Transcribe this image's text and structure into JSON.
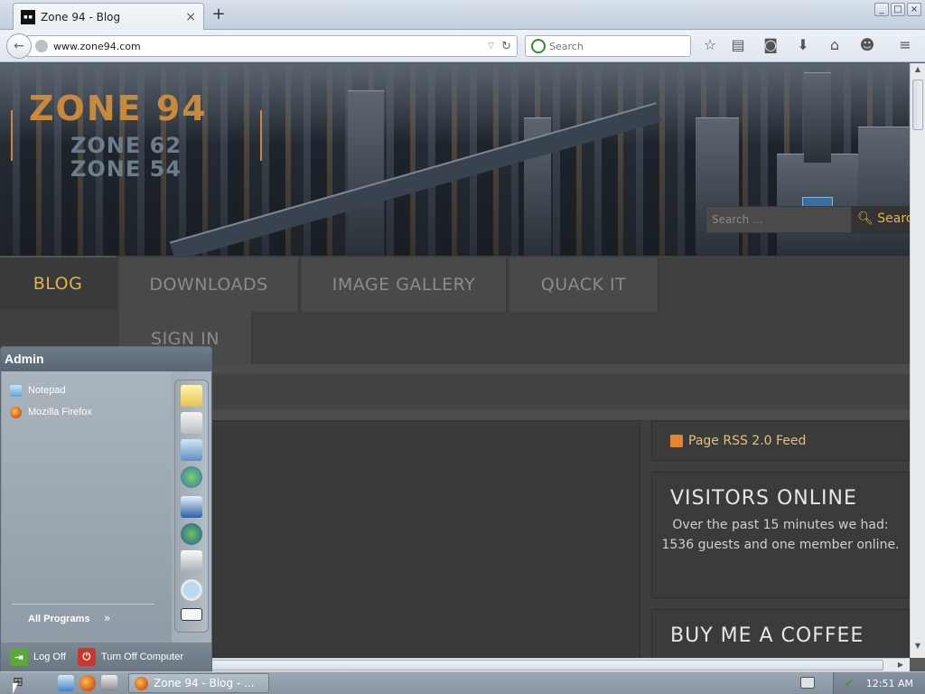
{
  "browser": {
    "tab_title": "Zone 94 - Blog",
    "tab_favicon": "zone94-favicon",
    "tab_close": "×",
    "new_tab": "+",
    "url": "www.zone94.com",
    "search_placeholder": "Search",
    "window_controls": [
      "_",
      "□",
      "×"
    ],
    "toolbar_icons": [
      "bookmark-star-icon",
      "reading-list-icon",
      "pocket-icon",
      "download-icon",
      "home-icon",
      "smiley-icon",
      "menu-icon"
    ]
  },
  "site": {
    "logo_main": "ZONE 94",
    "logo_sub1": "ZONE 62",
    "logo_sub2": "ZONE 54",
    "menu": [
      {
        "label": "BLOG",
        "active": true
      },
      {
        "label": "DOWNLOADS",
        "active": false
      },
      {
        "label": "IMAGE GALLERY",
        "active": false
      },
      {
        "label": "QUACK IT",
        "active": false
      },
      {
        "label": "SIGN IN",
        "active": false
      }
    ],
    "search_placeholder": "Search ...",
    "search_button": "Search",
    "rss_label": "Page RSS 2.0 Feed",
    "visitors_title": "VISITORS ONLINE",
    "visitors_text": "Over the past 15 minutes we had: 1536 guests and one member online.",
    "coffee_title": "BUY ME A COFFEE",
    "accent_color": "#e1b14a"
  },
  "start_menu": {
    "user": "Admin",
    "programs": [
      {
        "label": "Notepad",
        "icon": "notepad-icon"
      },
      {
        "label": "Mozilla Firefox",
        "icon": "firefox-icon"
      }
    ],
    "all_programs": "All Programs",
    "right_icons": [
      "my-documents-icon",
      "recent-documents-icon",
      "my-computer-icon",
      "network-icon",
      "control-panel-icon",
      "internet-icon",
      "printer-icon",
      "search-icon",
      "run-icon"
    ],
    "log_off": "Log Off",
    "turn_off": "Turn Off Computer"
  },
  "taskbar": {
    "task_label": "Zone 94 - Blog - ...",
    "clock": "12:51 AM"
  }
}
